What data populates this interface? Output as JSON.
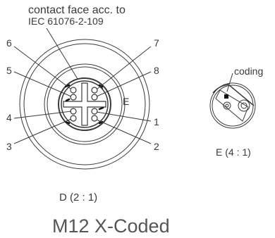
{
  "diagram": {
    "heading_line1": "contact face acc. to",
    "heading_line2": "IEC 61076-2-109",
    "pins": {
      "p1": "1",
      "p2": "2",
      "p3": "3",
      "p4": "4",
      "p5": "5",
      "p6": "6",
      "p7": "7",
      "p8": "8"
    },
    "detail_marker": "E",
    "coding_label": "coding",
    "detail_view_caption": "E (4 : 1)",
    "main_view_caption": "D (2 : 1)",
    "product_name": "M12 X-Coded"
  },
  "colors": {
    "line": "#3a3a3a",
    "text": "#3a3a3a"
  }
}
